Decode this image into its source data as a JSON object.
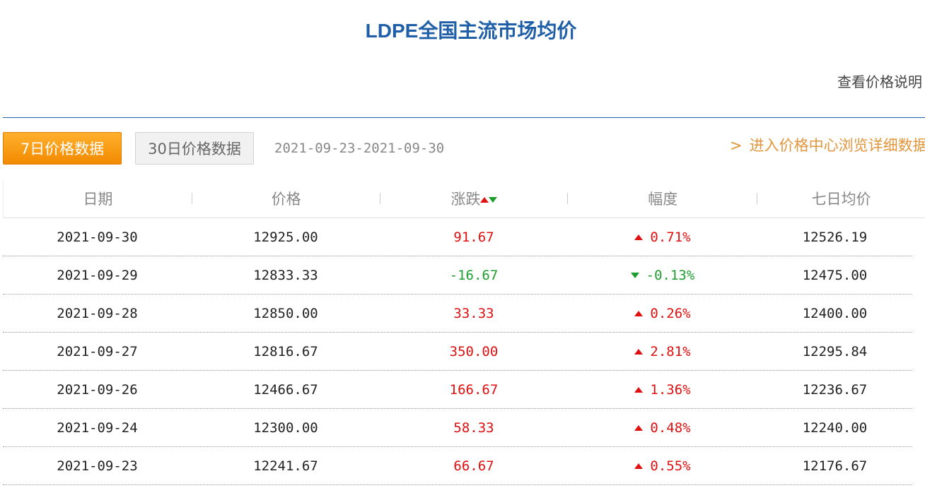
{
  "page": {
    "title": "LDPE全国主流市场均价",
    "explain_link": "查看价格说明"
  },
  "tabs": [
    {
      "label": "7日价格数据",
      "active": true
    },
    {
      "label": "30日价格数据",
      "active": false
    }
  ],
  "date_range": "2021-09-23-2021-09-30",
  "center_link": "进入价格中心浏览详细数据",
  "colors": {
    "up": "#e01010",
    "down": "#1e9e2e",
    "title": "#1f5fa8",
    "accent": "#f28a00",
    "link": "#e2963c"
  },
  "table": {
    "headers": [
      "日期",
      "价格",
      "涨跌",
      "幅度",
      "七日均价"
    ],
    "rows": [
      {
        "date": "2021-09-30",
        "price": "12925.00",
        "change": "91.67",
        "pct": "0.71%",
        "dir": "up",
        "avg7": "12526.19"
      },
      {
        "date": "2021-09-29",
        "price": "12833.33",
        "change": "-16.67",
        "pct": "-0.13%",
        "dir": "down",
        "avg7": "12475.00"
      },
      {
        "date": "2021-09-28",
        "price": "12850.00",
        "change": "33.33",
        "pct": "0.26%",
        "dir": "up",
        "avg7": "12400.00"
      },
      {
        "date": "2021-09-27",
        "price": "12816.67",
        "change": "350.00",
        "pct": "2.81%",
        "dir": "up",
        "avg7": "12295.84"
      },
      {
        "date": "2021-09-26",
        "price": "12466.67",
        "change": "166.67",
        "pct": "1.36%",
        "dir": "up",
        "avg7": "12236.67"
      },
      {
        "date": "2021-09-24",
        "price": "12300.00",
        "change": "58.33",
        "pct": "0.48%",
        "dir": "up",
        "avg7": "12240.00"
      },
      {
        "date": "2021-09-23",
        "price": "12241.67",
        "change": "66.67",
        "pct": "0.55%",
        "dir": "up",
        "avg7": "12176.67"
      }
    ]
  }
}
